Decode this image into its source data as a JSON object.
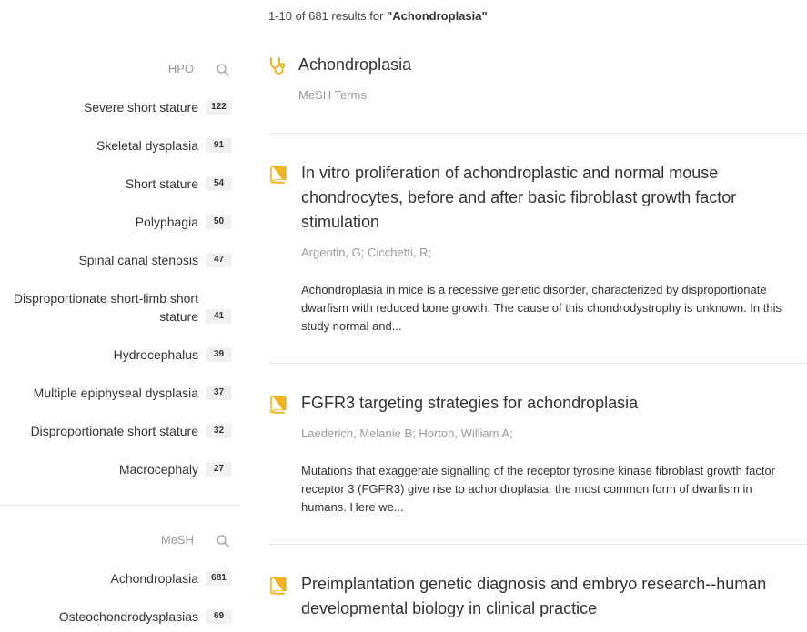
{
  "summary": {
    "prefix": "1-10 of 681 results for ",
    "query": "\"Achondroplasia\""
  },
  "sidebar": {
    "hpo": {
      "title": "HPO",
      "items": [
        {
          "label": "Severe short stature",
          "count": "122"
        },
        {
          "label": "Skeletal dysplasia",
          "count": "91"
        },
        {
          "label": "Short stature",
          "count": "54"
        },
        {
          "label": "Polyphagia",
          "count": "50"
        },
        {
          "label": "Spinal canal stenosis",
          "count": "47"
        },
        {
          "label_line1": "Disproportionate short-limb short",
          "label_line2": "stature",
          "count": "41"
        },
        {
          "label": "Hydrocephalus",
          "count": "39"
        },
        {
          "label": "Multiple epiphyseal dysplasia",
          "count": "37"
        },
        {
          "label": "Disproportionate short stature",
          "count": "32"
        },
        {
          "label": "Macrocephaly",
          "count": "27"
        }
      ]
    },
    "mesh": {
      "title": "MeSH",
      "items": [
        {
          "label": "Achondroplasia",
          "count": "681"
        },
        {
          "label": "Osteochondrodysplasias",
          "count": "69"
        }
      ]
    }
  },
  "results": {
    "mesh_term": {
      "title": "Achondroplasia",
      "subtitle": "MeSH Terms"
    },
    "articles": [
      {
        "title": "In vitro proliferation of achondroplastic and normal mouse chondrocytes, before and after basic fibroblast growth factor stimulation",
        "authors": "Argentin, G;  Cicchetti, R;",
        "abstract": "Achondroplasia in mice is a recessive genetic disorder, characterized by disproportionate dwarfism with reduced bone growth. The cause of this chondrodystrophy is unknown. In this study normal and..."
      },
      {
        "title": "FGFR3 targeting strategies for achondroplasia",
        "authors": "Laederich, Melanie B;  Horton, William A;",
        "abstract": "Mutations that exaggerate signalling of the receptor tyrosine kinase fibroblast growth factor receptor 3 (FGFR3) give rise to achondroplasia, the most common form of dwarfism in humans. Here we..."
      },
      {
        "title": "Preimplantation genetic diagnosis and embryo research--human developmental biology in clinical practice"
      }
    ]
  },
  "icons": {
    "stethoscope": "stethoscope-icon",
    "book": "book-icon",
    "search": "search-icon"
  },
  "colors": {
    "accent": "#f0b429",
    "muted": "#999999"
  }
}
